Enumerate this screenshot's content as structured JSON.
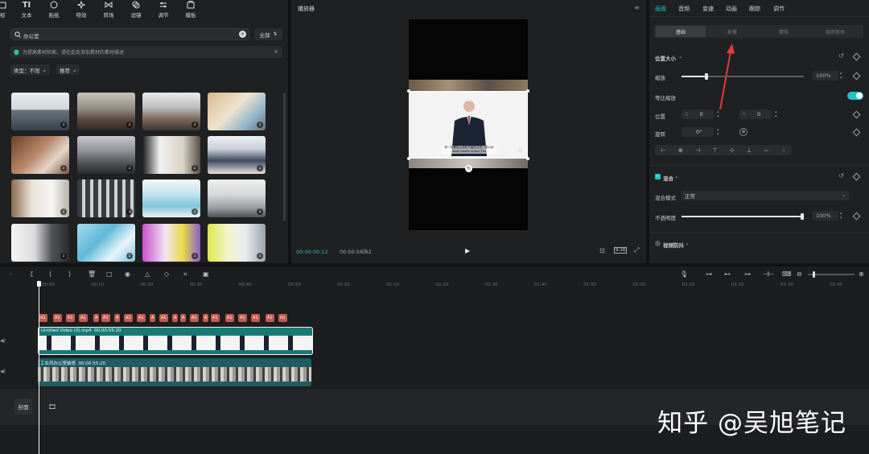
{
  "toolbar": {
    "items": [
      "视",
      "文本",
      "贴纸",
      "特效",
      "转场",
      "滤镜",
      "调节",
      "模板"
    ]
  },
  "media": {
    "search_value": "办公室",
    "all_label": "全部",
    "notice": "为提高素材检索，请在此处添加素材的素材描述",
    "type_label": "类型：不限",
    "sort_label": "推荐"
  },
  "player": {
    "title": "播放器",
    "caption_line1": "你一年看见公司你下面的文字，那么你",
    "caption_line2": "Team Health Action The",
    "time_current": "00:00:00:12",
    "time_total": "00:00:56:02",
    "ratio": "9:16"
  },
  "inspector": {
    "tabs": [
      "画面",
      "音频",
      "变速",
      "动画",
      "跟踪",
      "调节"
    ],
    "subtabs": [
      "基础",
      "抠像",
      "蒙版",
      "美颜美体"
    ],
    "position_size": "位置大小",
    "scale_label": "缩放",
    "scale_value": "100%",
    "uniform_label": "等比缩放",
    "position_label": "位置",
    "pos_x_label": "X",
    "pos_x": "0",
    "pos_y_label": "Y",
    "pos_y": "0",
    "rotate_label": "旋转",
    "rotate_value": "0°",
    "blend_title": "混合",
    "blend_mode_label": "混合模式",
    "blend_mode_value": "正常",
    "opacity_label": "不透明度",
    "opacity_value": "100%",
    "stabilize_label": "视频防抖",
    "accent": "#21c4c4"
  },
  "timeline": {
    "ticks": [
      "00:00",
      "00:10",
      "00:20",
      "00:30",
      "00:40",
      "00:50",
      "01:00",
      "01:10",
      "01:20",
      "01:30",
      "01:40",
      "01:50",
      "02:00",
      "02:10",
      "02:20",
      "02:30",
      "02:40"
    ],
    "text_chips": [
      "A1",
      "A1",
      "A1",
      "A1",
      "A",
      "A1",
      "A",
      "A1",
      "A1",
      "A",
      "A1",
      "A",
      "A",
      "A1",
      "A",
      "A1",
      "A1",
      "A1",
      "A1",
      "A1",
      "A1"
    ],
    "clip1_label": "Untitled Video (3).mp4",
    "clip1_duration": "00:00:55:20",
    "clip2_label": "工业风办公室装修",
    "clip2_duration": "00:00:55:20",
    "cover_label": "封面"
  },
  "watermark": "知乎 @吴旭笔记"
}
